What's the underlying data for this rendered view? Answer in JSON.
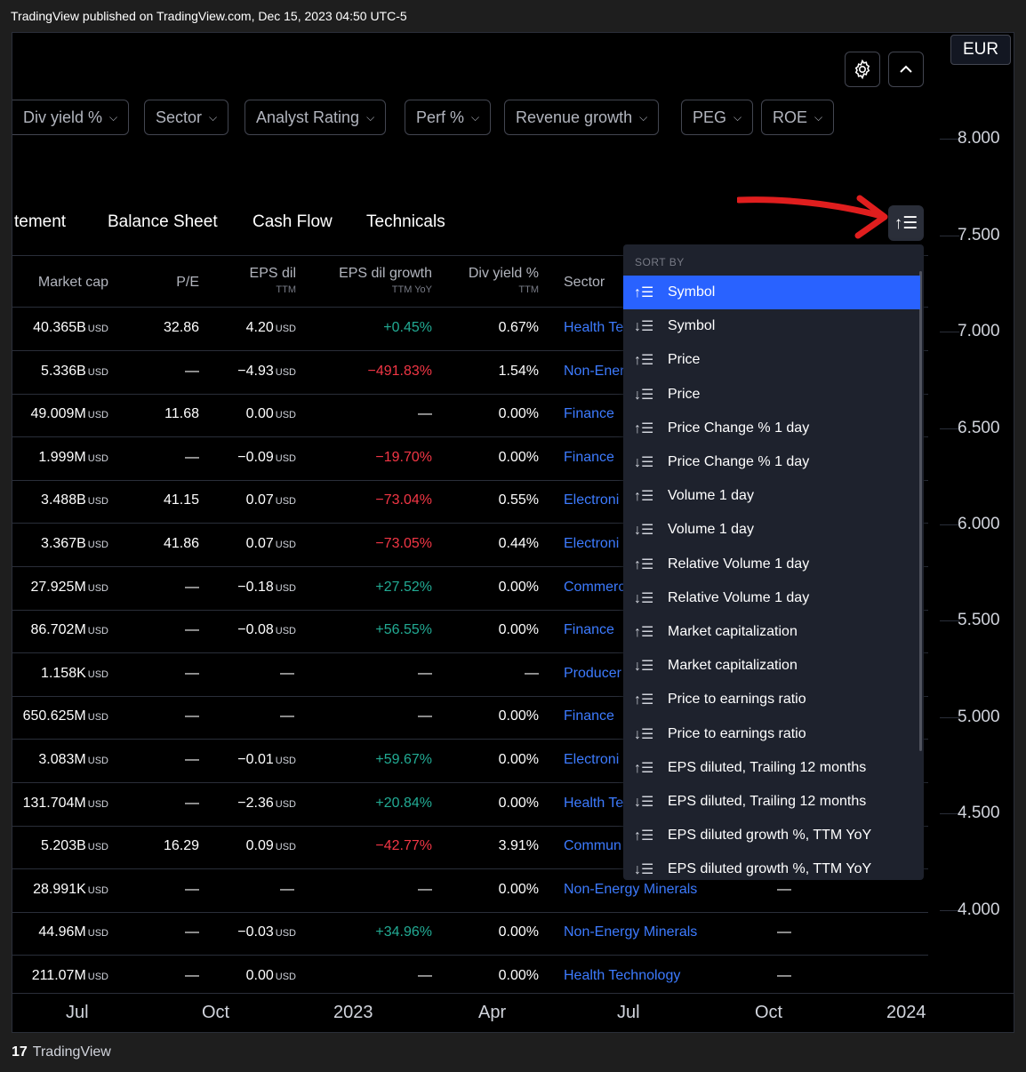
{
  "publish_line": "TradingView published on TradingView.com, Dec 15, 2023 04:50 UTC-5",
  "currency": "EUR",
  "price_axis": [
    "8.000",
    "7.500",
    "7.000",
    "6.500",
    "6.000",
    "5.500",
    "5.000",
    "4.500",
    "4.000"
  ],
  "time_axis": [
    "Jul",
    "Oct",
    "2023",
    "Apr",
    "Jul",
    "Oct",
    "2024"
  ],
  "filters": [
    "Div yield %",
    "Sector",
    "Analyst Rating",
    "Perf %",
    "Revenue growth",
    "PEG",
    "ROE"
  ],
  "tabs": [
    "tement",
    "Balance Sheet",
    "Cash Flow",
    "Technicals"
  ],
  "columns": {
    "market_cap": "Market cap",
    "pe": "P/E",
    "eps": "EPS dil",
    "eps_sub": "TTM",
    "eps_growth": "EPS dil growth",
    "eps_growth_sub": "TTM YoY",
    "div_yield": "Div yield %",
    "div_yield_sub": "TTM",
    "sector": "Sector"
  },
  "unit": "USD",
  "rows": [
    {
      "mcap": "40.365B",
      "pe": "32.86",
      "eps": "4.20",
      "eps_unit": "USD",
      "growth": "+0.45%",
      "g": "pos",
      "div": "0.67%",
      "sector": "Health Te"
    },
    {
      "mcap": "5.336B",
      "pe": "—",
      "eps": "−4.93",
      "eps_unit": "USD",
      "growth": "−491.83%",
      "g": "neg",
      "div": "1.54%",
      "sector": "Non-Ener"
    },
    {
      "mcap": "49.009M",
      "pe": "11.68",
      "eps": "0.00",
      "eps_unit": "USD",
      "growth": "—",
      "g": "",
      "div": "0.00%",
      "sector": "Finance"
    },
    {
      "mcap": "1.999M",
      "pe": "—",
      "eps": "−0.09",
      "eps_unit": "USD",
      "growth": "−19.70%",
      "g": "neg",
      "div": "0.00%",
      "sector": "Finance"
    },
    {
      "mcap": "3.488B",
      "pe": "41.15",
      "eps": "0.07",
      "eps_unit": "USD",
      "growth": "−73.04%",
      "g": "neg",
      "div": "0.55%",
      "sector": "Electroni"
    },
    {
      "mcap": "3.367B",
      "pe": "41.86",
      "eps": "0.07",
      "eps_unit": "USD",
      "growth": "−73.05%",
      "g": "neg",
      "div": "0.44%",
      "sector": "Electroni"
    },
    {
      "mcap": "27.925M",
      "pe": "—",
      "eps": "−0.18",
      "eps_unit": "USD",
      "growth": "+27.52%",
      "g": "pos",
      "div": "0.00%",
      "sector": "Commerc"
    },
    {
      "mcap": "86.702M",
      "pe": "—",
      "eps": "−0.08",
      "eps_unit": "USD",
      "growth": "+56.55%",
      "g": "pos",
      "div": "0.00%",
      "sector": "Finance"
    },
    {
      "mcap": "1.158K",
      "pe": "—",
      "eps": "—",
      "eps_unit": "",
      "growth": "—",
      "g": "",
      "div": "—",
      "sector": "Producer"
    },
    {
      "mcap": "650.625M",
      "pe": "—",
      "eps": "—",
      "eps_unit": "",
      "growth": "—",
      "g": "",
      "div": "0.00%",
      "sector": "Finance"
    },
    {
      "mcap": "3.083M",
      "pe": "—",
      "eps": "−0.01",
      "eps_unit": "USD",
      "growth": "+59.67%",
      "g": "pos",
      "div": "0.00%",
      "sector": "Electroni"
    },
    {
      "mcap": "131.704M",
      "pe": "—",
      "eps": "−2.36",
      "eps_unit": "USD",
      "growth": "+20.84%",
      "g": "pos",
      "div": "0.00%",
      "sector": "Health Te"
    },
    {
      "mcap": "5.203B",
      "pe": "16.29",
      "eps": "0.09",
      "eps_unit": "USD",
      "growth": "−42.77%",
      "g": "neg",
      "div": "3.91%",
      "sector": "Commun"
    },
    {
      "mcap": "28.991K",
      "pe": "—",
      "eps": "—",
      "eps_unit": "",
      "growth": "—",
      "g": "",
      "div": "0.00%",
      "sector": "Non-Energy Minerals",
      "extra": "—"
    },
    {
      "mcap": "44.96M",
      "pe": "—",
      "eps": "−0.03",
      "eps_unit": "USD",
      "growth": "+34.96%",
      "g": "pos",
      "div": "0.00%",
      "sector": "Non-Energy Minerals",
      "extra": "—"
    },
    {
      "mcap": "211.07M",
      "pe": "—",
      "eps": "0.00",
      "eps_unit": "USD",
      "growth": "—",
      "g": "",
      "div": "0.00%",
      "sector": "Health Technology",
      "extra": "—"
    }
  ],
  "sort_menu": {
    "header": "SORT BY",
    "items": [
      {
        "dir": "asc",
        "label": "Symbol",
        "selected": true
      },
      {
        "dir": "desc",
        "label": "Symbol"
      },
      {
        "dir": "asc",
        "label": "Price"
      },
      {
        "dir": "desc",
        "label": "Price"
      },
      {
        "dir": "asc",
        "label": "Price Change % 1 day"
      },
      {
        "dir": "desc",
        "label": "Price Change % 1 day"
      },
      {
        "dir": "asc",
        "label": "Volume 1 day"
      },
      {
        "dir": "desc",
        "label": "Volume 1 day"
      },
      {
        "dir": "asc",
        "label": "Relative Volume 1 day"
      },
      {
        "dir": "desc",
        "label": "Relative Volume 1 day"
      },
      {
        "dir": "asc",
        "label": "Market capitalization"
      },
      {
        "dir": "desc",
        "label": "Market capitalization"
      },
      {
        "dir": "asc",
        "label": "Price to earnings ratio"
      },
      {
        "dir": "desc",
        "label": "Price to earnings ratio"
      },
      {
        "dir": "asc",
        "label": "EPS diluted, Trailing 12 months"
      },
      {
        "dir": "desc",
        "label": "EPS diluted, Trailing 12 months"
      },
      {
        "dir": "asc",
        "label": "EPS diluted growth %, TTM YoY"
      },
      {
        "dir": "desc",
        "label": "EPS diluted growth %, TTM YoY"
      }
    ]
  },
  "footer": {
    "logo": "17",
    "brand": "TradingView"
  },
  "colors": {
    "accent": "#2962ff",
    "positive": "#22ab94",
    "negative": "#f23645",
    "annotation": "#e01e1e"
  }
}
